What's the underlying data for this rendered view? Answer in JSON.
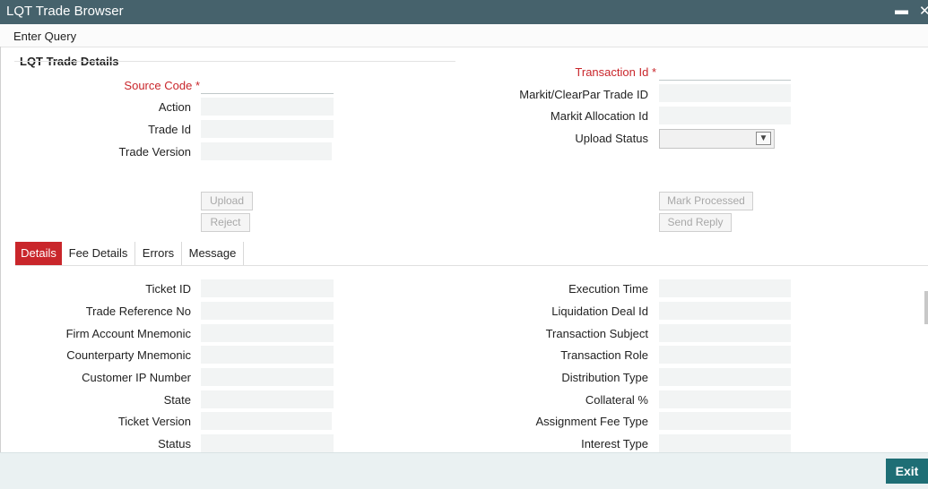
{
  "window": {
    "title": "LQT Trade Browser",
    "minimize_glyph": "▬",
    "close_glyph": "✕"
  },
  "menu": {
    "enter_query": "Enter Query"
  },
  "section": {
    "title": "LQT Trade Details"
  },
  "left_fields": [
    {
      "label": "Source Code",
      "required": true,
      "value": ""
    },
    {
      "label": "Action",
      "value": ""
    },
    {
      "label": "Trade Id",
      "value": ""
    },
    {
      "label": "Trade Version",
      "value": ""
    }
  ],
  "right_fields": [
    {
      "label": "Transaction Id",
      "required": true,
      "value": ""
    },
    {
      "label": "Markit/ClearPar Trade ID",
      "value": ""
    },
    {
      "label": "Markit Allocation Id",
      "value": ""
    },
    {
      "label": "Upload Status",
      "value": ""
    }
  ],
  "required_mark": "*",
  "buttons": {
    "upload": "Upload",
    "reject": "Reject",
    "mark_processed": "Mark Processed",
    "send_reply": "Send Reply",
    "exit": "Exit"
  },
  "tabs": [
    "Details",
    "Fee Details",
    "Errors",
    "Message"
  ],
  "details_left": [
    "Ticket ID",
    "Trade Reference No",
    "Firm Account Mnemonic",
    "Counterparty Mnemonic",
    "Customer IP Number",
    "State",
    "Ticket Version",
    "Status"
  ],
  "details_right": [
    "Execution Time",
    "Liquidation Deal Id",
    "Transaction Subject",
    "Transaction Role",
    "Distribution Type",
    "Collateral %",
    "Assignment Fee Type",
    "Interest Type"
  ],
  "colors": {
    "titlebar": "#46626c",
    "required": "#c9262b",
    "active_tab": "#c9262b",
    "exit_button": "#1e6e75"
  }
}
